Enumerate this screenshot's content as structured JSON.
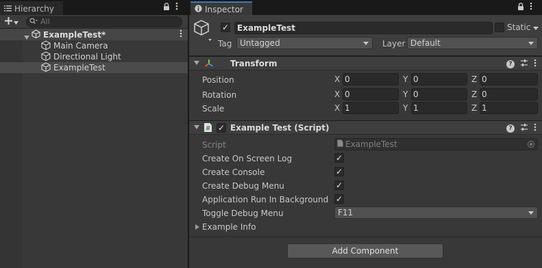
{
  "hierarchy": {
    "tab_label": "Hierarchy",
    "search_placeholder": "All",
    "scene": {
      "name": "ExampleTest*"
    },
    "items": [
      {
        "label": "Main Camera"
      },
      {
        "label": "Directional Light"
      },
      {
        "label": "ExampleTest",
        "selected": true
      }
    ]
  },
  "inspector": {
    "tab_label": "Inspector",
    "object_name": "ExampleTest",
    "active": true,
    "static_label": "Static",
    "tag_label": "Tag",
    "tag_value": "Untagged",
    "layer_label": "Layer",
    "layer_value": "Default",
    "transform": {
      "title": "Transform",
      "rows": [
        {
          "label": "Position",
          "x": "0",
          "y": "0",
          "z": "0"
        },
        {
          "label": "Rotation",
          "x": "0",
          "y": "0",
          "z": "0"
        },
        {
          "label": "Scale",
          "x": "1",
          "y": "1",
          "z": "1"
        }
      ],
      "axis_labels": {
        "x": "X",
        "y": "Y",
        "z": "Z"
      }
    },
    "script_component": {
      "title": "Example Test (Script)",
      "enabled": true,
      "script_label": "Script",
      "script_value": "ExampleTest",
      "toggles": [
        {
          "label": "Create On Screen Log",
          "checked": true
        },
        {
          "label": "Create Console",
          "checked": true
        },
        {
          "label": "Create Debug Menu",
          "checked": true
        },
        {
          "label": "Application Run In Background",
          "checked": true
        }
      ],
      "toggle_debug_label": "Toggle Debug Menu",
      "toggle_debug_value": "F11",
      "foldout_label": "Example Info"
    },
    "add_component_label": "Add Component"
  },
  "colors": {
    "panel_bg": "#383838",
    "tab_accent": "#3a79bb",
    "field_bg": "#2a2a2a",
    "button_bg": "#585858"
  },
  "check_glyph": "✓"
}
